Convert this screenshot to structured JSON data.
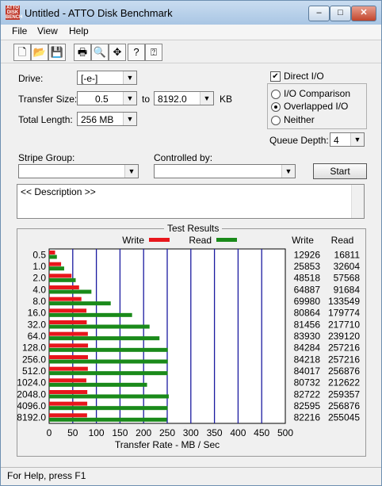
{
  "window": {
    "title": "Untitled - ATTO Disk Benchmark",
    "icon_text": "ATTO DISK BENCH",
    "min": "–",
    "max": "□",
    "close": "✕"
  },
  "menu": {
    "file": "File",
    "view": "View",
    "help": "Help"
  },
  "toolbar": {
    "icons": [
      "new-file-icon",
      "open-folder-icon",
      "save-icon",
      "print-icon",
      "print-preview-icon",
      "move-icon",
      "help-icon",
      "context-help-icon"
    ],
    "glyphs": [
      "🗋",
      "📂",
      "💾",
      "🖶",
      "🔍",
      "✥",
      "?",
      "⍰"
    ]
  },
  "form": {
    "drive_label": "Drive:",
    "drive_value": "[-e-]",
    "transfer_size_label": "Transfer Size:",
    "transfer_from": "0.5",
    "to_label": "to",
    "transfer_to": "8192.0",
    "kb_label": "KB",
    "total_length_label": "Total Length:",
    "total_length_value": "256 MB",
    "direct_io_label": "Direct I/O",
    "io_comparison_label": "I/O Comparison",
    "overlapped_io_label": "Overlapped I/O",
    "neither_label": "Neither",
    "queue_depth_label": "Queue Depth:",
    "queue_depth_value": "4",
    "stripe_group_label": "Stripe Group:",
    "stripe_group_value": "",
    "controlled_by_label": "Controlled by:",
    "controlled_by_value": "",
    "start_label": "Start",
    "description": "<< Description >>"
  },
  "results": {
    "title": "Test Results",
    "write_legend": "Write",
    "read_legend": "Read",
    "write_col": "Write",
    "read_col": "Read"
  },
  "chart_data": {
    "type": "bar",
    "title": "Test Results",
    "xlabel": "Transfer Rate - MB / Sec",
    "xlim": [
      0,
      500
    ],
    "xticks": [
      "0",
      "50",
      "100",
      "150",
      "200",
      "250",
      "300",
      "350",
      "400",
      "450",
      "500"
    ],
    "categories": [
      "0.5",
      "1.0",
      "2.0",
      "4.0",
      "8.0",
      "16.0",
      "32.0",
      "64.0",
      "128.0",
      "256.0",
      "512.0",
      "1024.0",
      "2048.0",
      "4096.0",
      "8192.0"
    ],
    "series": [
      {
        "name": "Write",
        "values": [
          12.6,
          25.3,
          47.4,
          63.4,
          68.3,
          79.0,
          79.6,
          82.0,
          82.3,
          82.2,
          82.0,
          78.8,
          80.8,
          80.7,
          80.3
        ]
      },
      {
        "name": "Read",
        "values": [
          16.4,
          31.8,
          56.2,
          89.5,
          130.4,
          175.6,
          212.6,
          233.6,
          251.2,
          251.2,
          250.9,
          207.3,
          253.3,
          250.9,
          249.1
        ]
      }
    ],
    "write_values_kbs": [
      "12926",
      "25853",
      "48518",
      "64887",
      "69980",
      "80864",
      "81456",
      "83930",
      "84284",
      "84218",
      "84017",
      "80732",
      "82722",
      "82595",
      "82216"
    ],
    "read_values_kbs": [
      "16811",
      "32604",
      "57568",
      "91684",
      "133549",
      "179774",
      "217710",
      "239120",
      "257216",
      "257216",
      "256876",
      "212622",
      "259357",
      "256876",
      "255045"
    ],
    "write_color": "#e8161c",
    "read_color": "#1a8a1a",
    "grid": true
  },
  "status": {
    "text": "For Help, press F1"
  }
}
